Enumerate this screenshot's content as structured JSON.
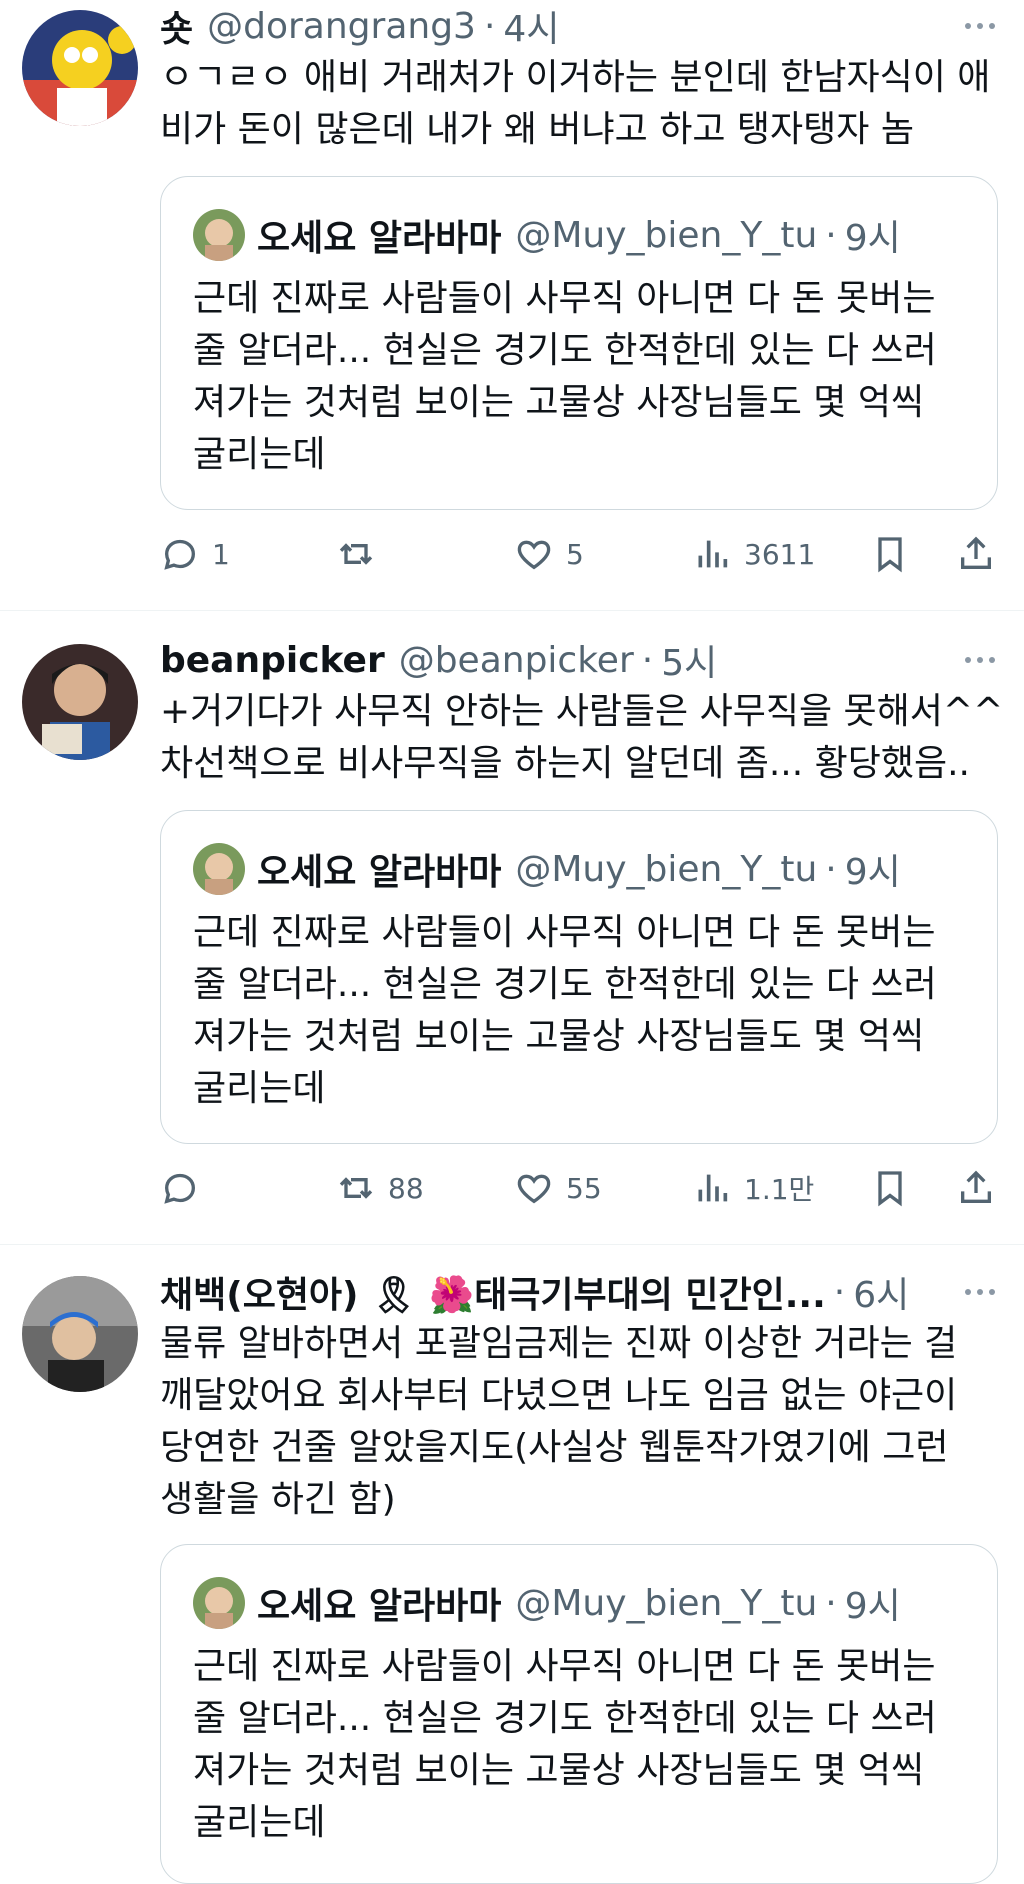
{
  "tweets": [
    {
      "name": "숏",
      "handle": "@dorangrang3",
      "time": "4시",
      "text_lines": [
        "ㅇㄱㄹㅇ 애비 거래처가 이거하는 분인데 한남자식이 애",
        "비가 돈이 많은데 내가 왜 버냐고 하고 탱자탱자 놈"
      ],
      "quote": {
        "name": "오세요 알라바마",
        "handle": "@Muy_bien_Y_tu",
        "time": "9시",
        "text_lines": [
          "근데 진짜로 사람들이 사무직 아니면 다 돈 못버는",
          "줄 알더라... 현실은 경기도 한적한데 있는 다 쓰러",
          "져가는 것처럼 보이는 고물상 사장님들도 몇 억씩",
          "굴리는데"
        ]
      },
      "actions": {
        "replies": "1",
        "retweets": "",
        "likes": "5",
        "views": "3611"
      }
    },
    {
      "name": "beanpicker",
      "handle": "@beanpicker",
      "time": "5시",
      "text_lines": [
        "+거기다가 사무직 안하는 사람들은 사무직을 못해서^^",
        "차선책으로 비사무직을 하는지 알던데 좀... 황당했음.."
      ],
      "quote": {
        "name": "오세요 알라바마",
        "handle": "@Muy_bien_Y_tu",
        "time": "9시",
        "text_lines": [
          "근데 진짜로 사람들이 사무직 아니면 다 돈 못버는",
          "줄 알더라... 현실은 경기도 한적한데 있는 다 쓰러",
          "져가는 것처럼 보이는 고물상 사장님들도 몇 억씩",
          "굴리는데"
        ]
      },
      "actions": {
        "replies": "",
        "retweets": "88",
        "likes": "55",
        "views": "1.1만"
      }
    },
    {
      "name": "채백(오현아) 🎗 🌺태극기부대의 민간인...",
      "handle": "",
      "time": "6시",
      "text_lines": [
        "물류 알바하면서 포괄임금제는 진짜 이상한 거라는 걸",
        "깨달았어요 회사부터 다녔으면 나도 임금 없는 야근이",
        "당연한 건줄 알았을지도(사실상 웹툰작가였기에 그런",
        "생활을 하긴 함)"
      ],
      "quote": {
        "name": "오세요 알라바마",
        "handle": "@Muy_bien_Y_tu",
        "time": "9시",
        "text_lines": [
          "근데 진짜로 사람들이 사무직 아니면 다 돈 못버는",
          "줄 알더라... 현실은 경기도 한적한데 있는 다 쓰러",
          "져가는 것처럼 보이는 고물상 사장님들도 몇 억씩",
          "굴리는데"
        ]
      }
    }
  ],
  "dot": "·",
  "icons": [
    "reply-icon",
    "retweet-icon",
    "like-icon",
    "views-icon",
    "bookmark-icon",
    "share-icon",
    "more-icon"
  ]
}
